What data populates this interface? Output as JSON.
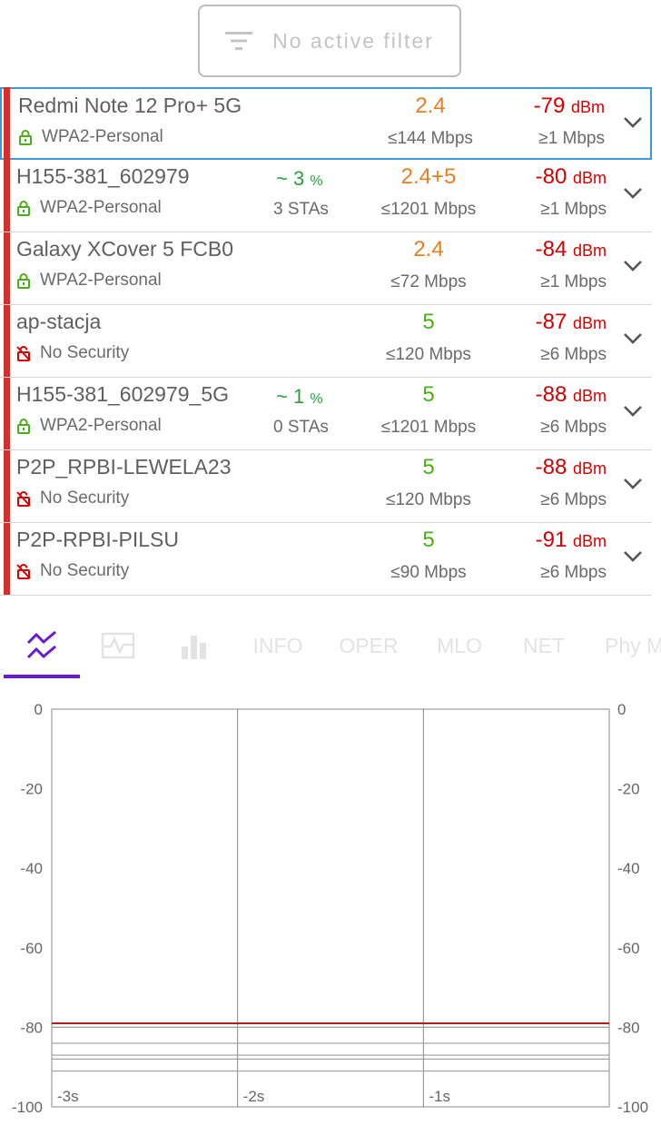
{
  "filter": {
    "label": "No active filter",
    "icon": "filter-icon"
  },
  "networks": [
    {
      "ssid": "Redmi Note 12 Pro+ 5G",
      "security": "WPA2-Personal",
      "secured": true,
      "ch_util": "",
      "ch_unit": "",
      "stas": "",
      "band": "2.4",
      "band_color": "#e67e22",
      "rate": "≤144 Mbps",
      "rssi": "-79",
      "unit": "dBm",
      "min_rate": "≥1 Mbps",
      "selected": true
    },
    {
      "ssid": "H155-381_602979",
      "security": "WPA2-Personal",
      "secured": true,
      "ch_util": "~ 3",
      "ch_unit": "%",
      "stas": "3 STAs",
      "band": "2.4+5",
      "band_color": "#e67e22",
      "rate": "≤1201 Mbps",
      "rssi": "-80",
      "unit": "dBm",
      "min_rate": "≥1 Mbps",
      "selected": false
    },
    {
      "ssid": "Galaxy XCover 5 FCB0",
      "security": "WPA2-Personal",
      "secured": true,
      "ch_util": "",
      "ch_unit": "",
      "stas": "",
      "band": "2.4",
      "band_color": "#e67e22",
      "rate": "≤72 Mbps",
      "rssi": "-84",
      "unit": "dBm",
      "min_rate": "≥1 Mbps",
      "selected": false
    },
    {
      "ssid": "ap-stacja",
      "security": "No Security",
      "secured": false,
      "ch_util": "",
      "ch_unit": "",
      "stas": "",
      "band": "5",
      "band_color": "#4caf1a",
      "rate": "≤120 Mbps",
      "rssi": "-87",
      "unit": "dBm",
      "min_rate": "≥6 Mbps",
      "selected": false
    },
    {
      "ssid": "H155-381_602979_5G",
      "security": "WPA2-Personal",
      "secured": true,
      "ch_util": "~ 1",
      "ch_unit": "%",
      "stas": "0 STAs",
      "band": "5",
      "band_color": "#4caf1a",
      "rate": "≤1201 Mbps",
      "rssi": "-88",
      "unit": "dBm",
      "min_rate": "≥6 Mbps",
      "selected": false
    },
    {
      "ssid": "P2P_RPBI-LEWELA23",
      "security": "No Security",
      "secured": false,
      "ch_util": "",
      "ch_unit": "",
      "stas": "",
      "band": "5",
      "band_color": "#4caf1a",
      "rate": "≤120 Mbps",
      "rssi": "-88",
      "unit": "dBm",
      "min_rate": "≥6 Mbps",
      "selected": false
    },
    {
      "ssid": "P2P-RPBI-PILSU",
      "security": "No Security",
      "secured": false,
      "ch_util": "",
      "ch_unit": "",
      "stas": "",
      "band": "5",
      "band_color": "#4caf1a",
      "rate": "≤90 Mbps",
      "rssi": "-91",
      "unit": "dBm",
      "min_rate": "≥6 Mbps",
      "selected": false
    }
  ],
  "tabs": [
    {
      "kind": "icon",
      "icon": "signal-graph-icon",
      "active": true
    },
    {
      "kind": "icon",
      "icon": "time-graph-icon",
      "active": false
    },
    {
      "kind": "icon",
      "icon": "bar-chart-icon",
      "active": false
    },
    {
      "kind": "text",
      "label": "INFO",
      "active": false
    },
    {
      "kind": "text",
      "label": "OPER",
      "active": false
    },
    {
      "kind": "text",
      "label": "MLO",
      "active": false
    },
    {
      "kind": "text",
      "label": "NET",
      "active": false
    },
    {
      "kind": "text",
      "label": "Phy M",
      "active": false
    }
  ],
  "colors": {
    "accent": "#6a1bd1",
    "rssi": "#d50000",
    "secured": "#4caf1a",
    "unsecured": "#d50000",
    "row_bar": "#d32f2f"
  },
  "chart_data": {
    "type": "line",
    "ylim": [
      -100,
      0
    ],
    "y_ticks": [
      "0",
      "-20",
      "-40",
      "-60",
      "-80",
      "-100"
    ],
    "x_ticks": [
      "-3s",
      "-2s",
      "-1s"
    ],
    "series": [
      {
        "values": [
          -79,
          -79
        ],
        "color": "#b71c1c"
      },
      {
        "values": [
          -80,
          -80
        ],
        "color": "#9e9e9e"
      },
      {
        "values": [
          -84,
          -84
        ],
        "color": "#9e9e9e"
      },
      {
        "values": [
          -87,
          -87
        ],
        "color": "#9e9e9e"
      },
      {
        "values": [
          -88,
          -88
        ],
        "color": "#9e9e9e"
      },
      {
        "values": [
          -88,
          -88
        ],
        "color": "#9e9e9e"
      },
      {
        "values": [
          -91,
          -91
        ],
        "color": "#9e9e9e"
      }
    ]
  }
}
